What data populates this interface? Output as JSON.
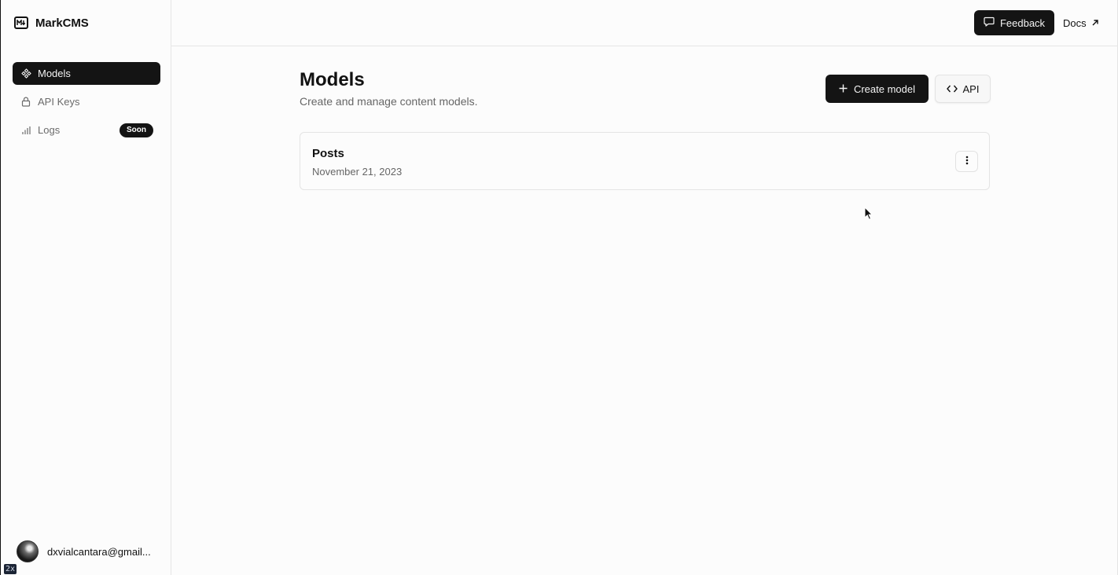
{
  "app": {
    "brand_name": "MarkCMS",
    "brand_icon": "markdown-logo-icon"
  },
  "sidebar": {
    "items": [
      {
        "label": "Models",
        "icon": "models-icon",
        "active": true
      },
      {
        "label": "API Keys",
        "icon": "lock-icon",
        "active": false
      },
      {
        "label": "Logs",
        "icon": "bar-chart-icon",
        "active": false,
        "badge": "Soon"
      }
    ],
    "user": {
      "email": "dxvialcantara@gmail..."
    }
  },
  "topbar": {
    "feedback_label": "Feedback",
    "docs_label": "Docs"
  },
  "main": {
    "title": "Models",
    "subtitle": "Create and manage content models.",
    "create_label": "Create model",
    "api_label": "API",
    "models": [
      {
        "name": "Posts",
        "date": "November 21, 2023"
      }
    ]
  },
  "overlay": {
    "zoom_badge": "2x"
  },
  "colors": {
    "accent_dark": "#141414",
    "background": "#fcfcfc",
    "muted_text": "#666666"
  }
}
